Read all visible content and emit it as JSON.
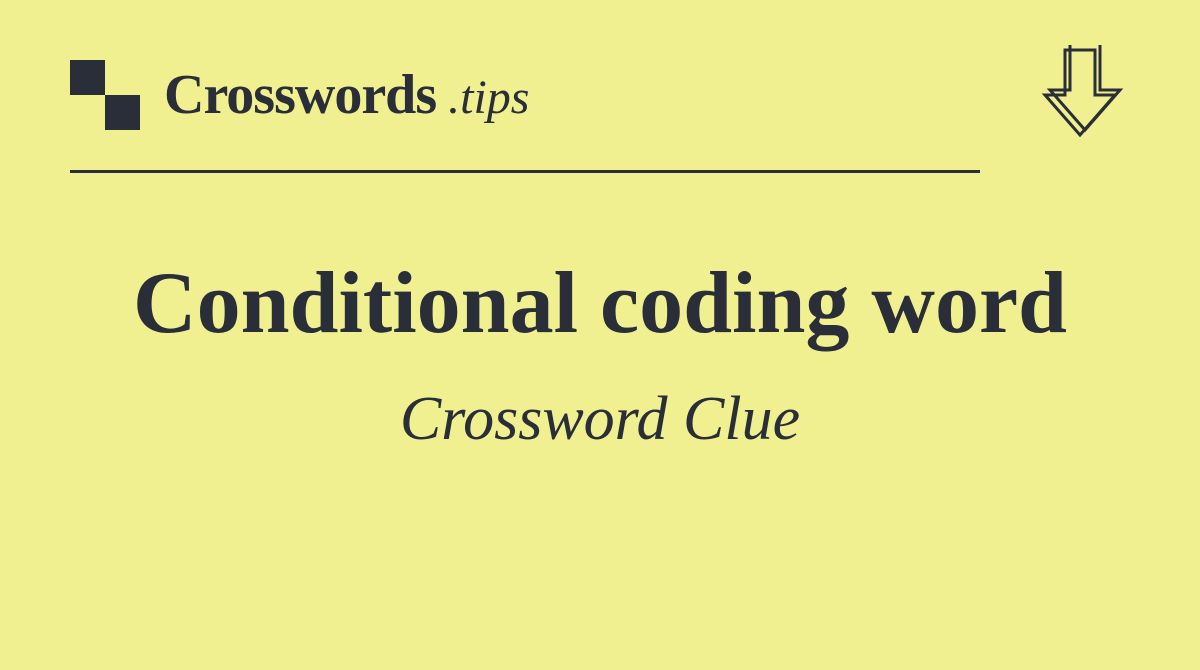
{
  "header": {
    "logo_main": "Crosswords",
    "logo_suffix": ".tips"
  },
  "content": {
    "clue_title": "Conditional coding word",
    "clue_subtitle": "Crossword Clue"
  }
}
